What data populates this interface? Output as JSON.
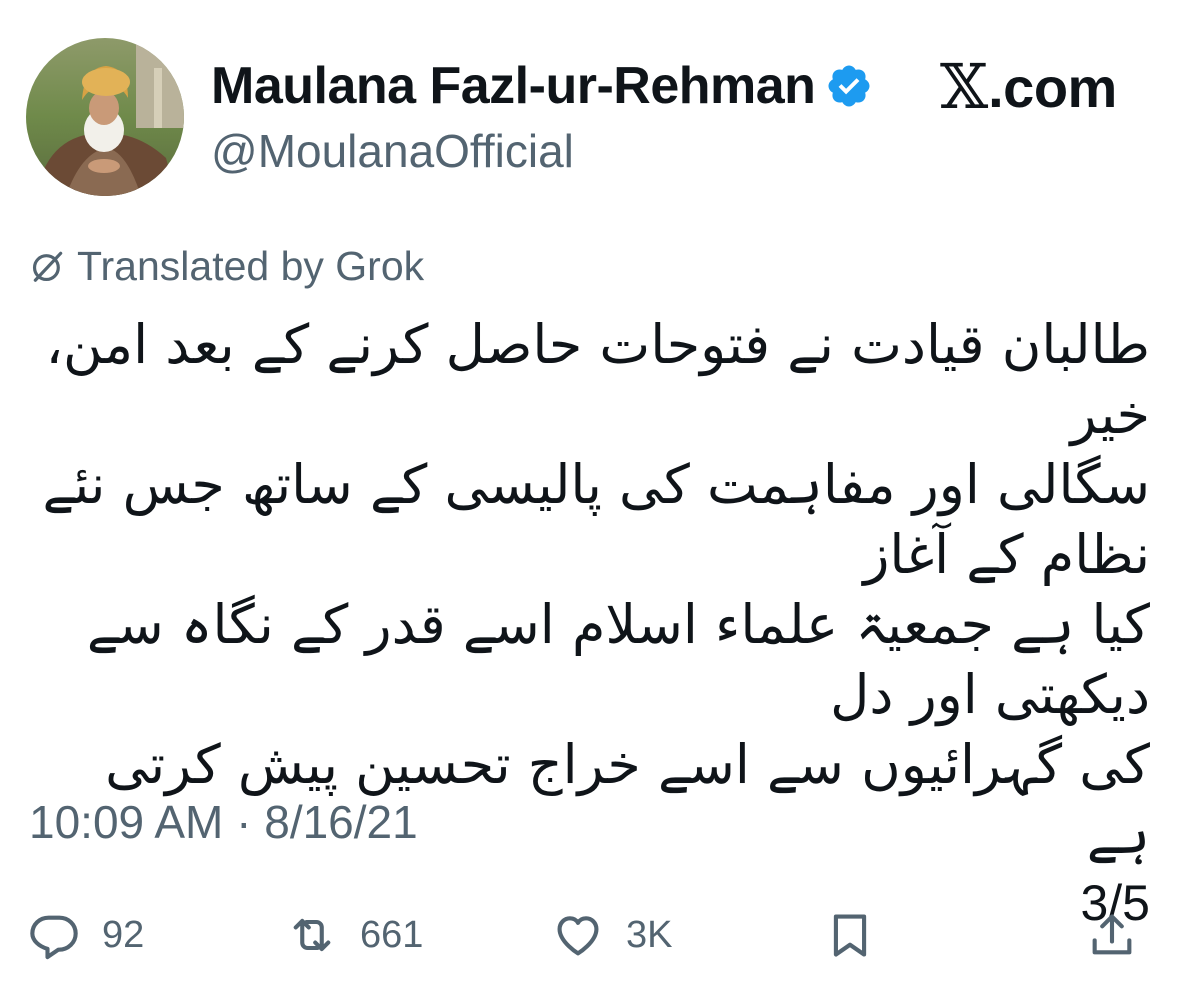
{
  "author": {
    "display_name": "Maulana Fazl-ur-Rehman",
    "handle": "@MoulanaOfficial",
    "verified": true,
    "verified_color": "#1d9bf0"
  },
  "brand": {
    "x_glyph": "𝕏",
    "suffix": ".com"
  },
  "translation": {
    "label": "Translated by Grok",
    "icon": "grok-icon"
  },
  "post": {
    "lines": [
      "طالبان قیادت نے فتوحات حاصل کرنے کے بعد امن، خیر",
      "سگالی اور مفاہمت کی پالیسی کے ساتھ جس نئے نظام کے آغاز",
      "کیا ہے جمعیۃ علماء اسلام اسے قدر کے نگاہ سے دیکھتی اور دل",
      "کی گہرائیوں سے اسے خراج تحسین پیش کرتی ہے"
    ],
    "thread_counter": "3/5"
  },
  "timestamp": "10:09 AM · 8/16/21",
  "actions": {
    "reply": {
      "icon": "reply-icon",
      "count": "92"
    },
    "repost": {
      "icon": "repost-icon",
      "count": "661"
    },
    "like": {
      "icon": "heart-icon",
      "count": "3K"
    },
    "bookmark": {
      "icon": "bookmark-icon"
    },
    "share": {
      "icon": "share-icon"
    }
  },
  "colors": {
    "text_primary": "#0f1419",
    "text_secondary": "#536471"
  }
}
